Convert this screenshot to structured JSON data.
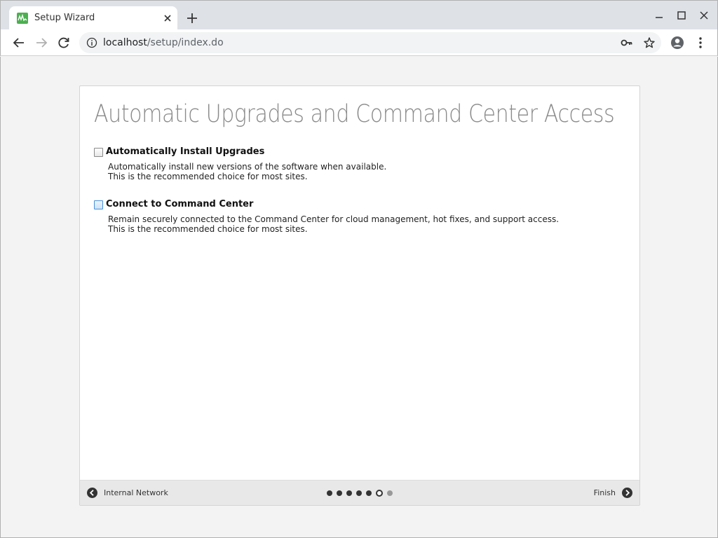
{
  "browser": {
    "tab_title": "Setup Wizard",
    "url_host": "localhost",
    "url_path": "/setup/index.do"
  },
  "wizard": {
    "title": "Automatic Upgrades and Command Center Access",
    "options": [
      {
        "label": "Automatically Install Upgrades",
        "checked": false,
        "desc_line1": "Automatically install new versions of the software when available.",
        "desc_line2": "This is the recommended choice for most sites."
      },
      {
        "label": "Connect to Command Center",
        "checked": false,
        "desc_line1": "Remain securely connected to the Command Center for cloud management, hot fixes, and support access.",
        "desc_line2": "This is the recommended choice for most sites."
      }
    ],
    "footer": {
      "prev_label": "Internal Network",
      "next_label": "Finish",
      "steps_total": 7,
      "current_step": 6
    }
  },
  "colors": {
    "title_gray": "#8a8a8a",
    "favicon_green": "#4caf50",
    "footer_bg": "#e8e8e8"
  },
  "icons": [
    "app-favicon-icon",
    "close-icon",
    "plus-icon",
    "minimize-icon",
    "maximize-icon",
    "window-close-icon",
    "back-arrow-icon",
    "forward-arrow-icon",
    "reload-icon",
    "info-icon",
    "key-icon",
    "star-icon",
    "account-circle-icon",
    "more-vert-icon",
    "circle-arrow-left-icon",
    "circle-arrow-right-icon"
  ]
}
